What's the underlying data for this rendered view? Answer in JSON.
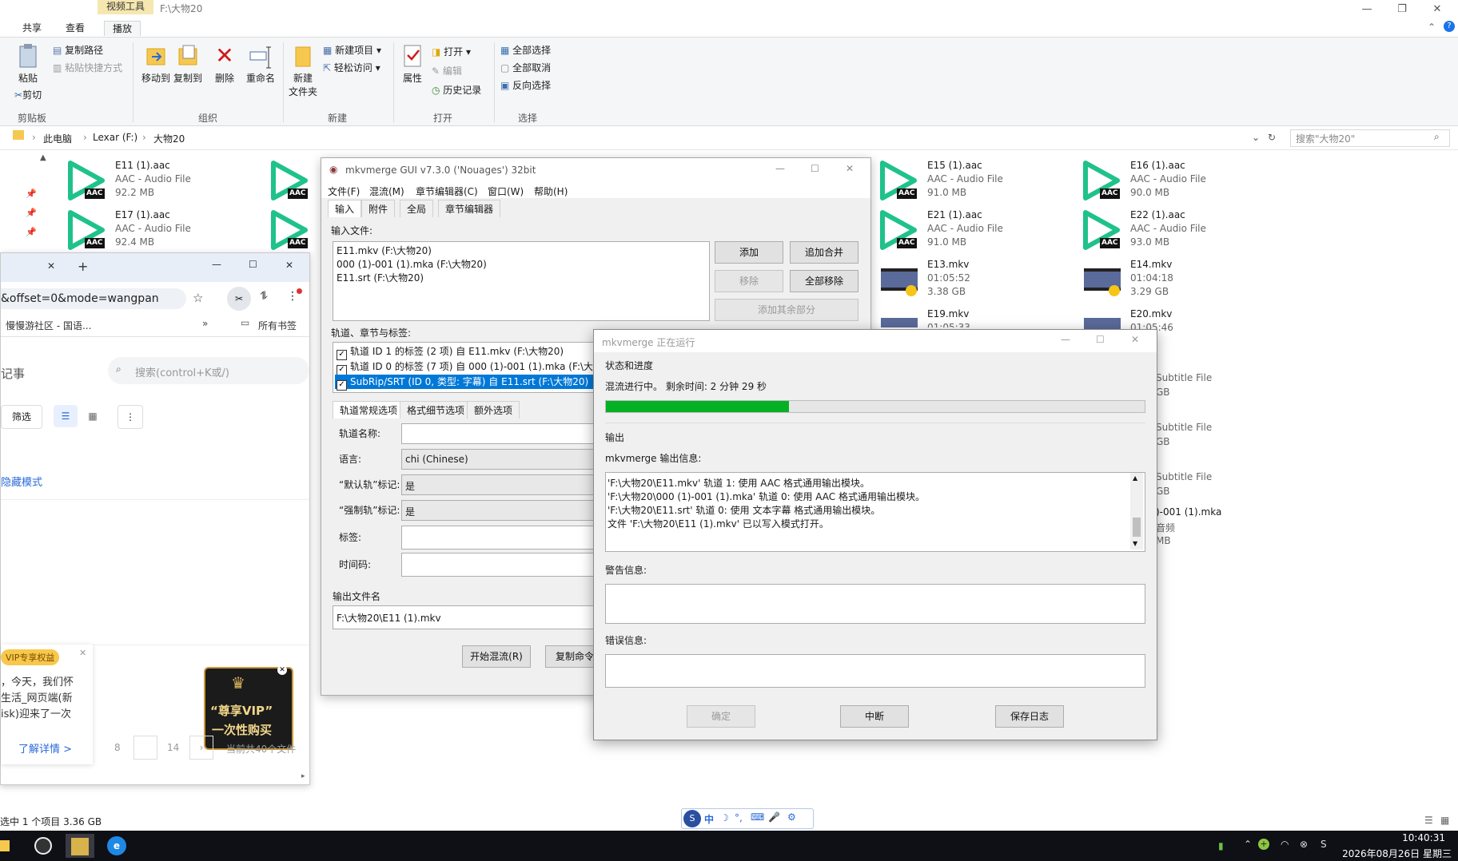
{
  "explorer": {
    "context_tab": "视频工具",
    "window_path": "F:\\大物20",
    "tabs": [
      "共享",
      "查看",
      "播放"
    ],
    "ribbon": {
      "paste": "粘贴",
      "copy_path": "复制路径",
      "paste_shortcut": "粘贴快捷方式",
      "cut": "剪切",
      "group_clipboard": "剪贴板",
      "move_to": "移动到",
      "copy_to": "复制到",
      "delete": "删除",
      "rename": "重命名",
      "group_organize": "组织",
      "new_folder_line1": "新建",
      "new_folder_line2": "文件夹",
      "new_item": "新建项目",
      "easy_access": "轻松访问",
      "group_new": "新建",
      "properties": "属性",
      "open": "打开",
      "edit": "编辑",
      "history": "历史记录",
      "group_open": "打开",
      "select_all": "全部选择",
      "select_none": "全部取消",
      "invert_selection": "反向选择",
      "group_select": "选择"
    },
    "breadcrumb": [
      "此电脑",
      "Lexar (F:)",
      "大物20"
    ],
    "search_placeholder": "搜索\"大物20\"",
    "files": [
      {
        "name": "E11 (1).aac",
        "type": "AAC - Audio File",
        "size": "92.2 MB"
      },
      {
        "name": "E17 (1).aac",
        "type": "AAC - Audio File",
        "size": "92.4 MB"
      },
      {
        "name": "E15 (1).aac",
        "type": "AAC - Audio File",
        "size": "91.0 MB"
      },
      {
        "name": "E16 (1).aac",
        "type": "AAC - Audio File",
        "size": "90.0 MB"
      },
      {
        "name": "E21 (1).aac",
        "type": "AAC - Audio File",
        "size": "91.0 MB"
      },
      {
        "name": "E22 (1).aac",
        "type": "AAC - Audio File",
        "size": "93.0 MB"
      },
      {
        "name": "E13.mkv",
        "type": "01:05:52",
        "size": "3.38 GB"
      },
      {
        "name": "E14.mkv",
        "type": "01:04:18",
        "size": "3.29 GB"
      },
      {
        "name": "E19.mkv",
        "type": "01:05:33",
        "size": ""
      },
      {
        "name": "E20.mkv",
        "type": "01:05:46",
        "size": "B"
      }
    ],
    "partial_right": {
      "sub1": "Subtitle File",
      "sub2": "Subtitle File",
      "sub3": "Subtitle File",
      "gb1": "GB",
      "gb2": "GB",
      "gb3": "GB",
      "mka": ")-001 (1).mka",
      "mka_type": "音频",
      "mka_size": "MB"
    },
    "status": "选中 1 个项目  3.36 GB"
  },
  "browser": {
    "url_fragment": "&offset=0&mode=wangpan",
    "bookmark": "慢慢游社区 - 国语...",
    "all_bookmarks": "所有书签",
    "notes_label": "记事",
    "search_placeholder": "搜索(control+K或/)",
    "filter": "筛选",
    "hidden_mode": "隐藏模式",
    "vip_badge": "VIP专享权益",
    "promo_line1": "，今天，我们怀",
    "promo_line2": "生活_网页端(新",
    "promo_line3": "isk)迎来了一次",
    "learn_more": "了解详情 >",
    "vip_ad_line1": "“尊享VIP”",
    "vip_ad_line2": "一次性购买",
    "pages": [
      "8",
      "",
      "14"
    ],
    "total_files": "当前共40个文件"
  },
  "mkv_gui": {
    "title": "mkvmerge GUI v7.3.0 ('Nouages') 32bit",
    "menus": [
      "文件(F)",
      "混流(M)",
      "章节编辑器(C)",
      "窗口(W)",
      "帮助(H)"
    ],
    "tabs": [
      "输入",
      "附件",
      "全局",
      "章节编辑器"
    ],
    "input_files_label": "输入文件:",
    "input_files": [
      "E11.mkv (F:\\大物20)",
      "000 (1)-001 (1).mka (F:\\大物20)",
      "E11.srt (F:\\大物20)"
    ],
    "btn_add": "添加",
    "btn_append": "追加合并",
    "btn_remove": "移除",
    "btn_remove_all": "全部移除",
    "btn_add_other": "添加其余部分",
    "tracks_label": "轨道、章节与标签:",
    "tracks": [
      "轨道 ID 1 的标签 (2 项) 自 E11.mkv (F:\\大物20)",
      "轨道 ID 0 的标签 (7 项) 自 000 (1)-001 (1).mka (F:\\大物",
      "SubRip/SRT (ID 0, 类型: 字幕) 自 E11.srt (F:\\大物20)"
    ],
    "subtabs": [
      "轨道常规选项",
      "格式细节选项",
      "额外选项"
    ],
    "track_name_label": "轨道名称:",
    "language_label": "语言:",
    "language_value": "chi (Chinese)",
    "default_label": "“默认轨”标记:",
    "default_value": "是",
    "forced_label": "“强制轨”标记:",
    "forced_value": "是",
    "tags_label": "标签:",
    "timecodes_label": "时间码:",
    "output_label": "输出文件名",
    "output_value": "F:\\大物20\\E11 (1).mkv",
    "btn_start": "开始混流(R)",
    "btn_copy_cmd": "复制命令行"
  },
  "progress_dialog": {
    "title": "mkvmerge 正在运行",
    "status_group": "状态和进度",
    "status_text": "混流进行中。 剩余时间: 2 分钟 29 秒",
    "progress": 0.34,
    "progress_color": "#06b025",
    "output_group": "输出",
    "output_label": "mkvmerge 输出信息:",
    "output_lines": [
      "'F:\\大物20\\E11.mkv' 轨道 1: 使用 AAC 格式通用输出模块。",
      "'F:\\大物20\\000 (1)-001 (1).mka' 轨道 0: 使用 AAC 格式通用输出模块。",
      "'F:\\大物20\\E11.srt' 轨道 0: 使用 文本字幕 格式通用输出模块。",
      "文件 'F:\\大物20\\E11 (1).mkv' 已以写入模式打开。"
    ],
    "warnings_label": "警告信息:",
    "errors_label": "错误信息:",
    "btn_ok": "确定",
    "btn_abort": "中断",
    "btn_save_log": "保存日志"
  },
  "ime_bar": {
    "items": [
      "中",
      "☽",
      "°,",
      "⌨",
      "🎤",
      "⚙"
    ]
  },
  "taskbar": {
    "time": "10:40:31",
    "date": "2026年08月26日 星期三"
  },
  "colors": {
    "accent_green": "#06b025",
    "selection_blue": "#0078d7",
    "aac_icon": "#1fc28b"
  }
}
